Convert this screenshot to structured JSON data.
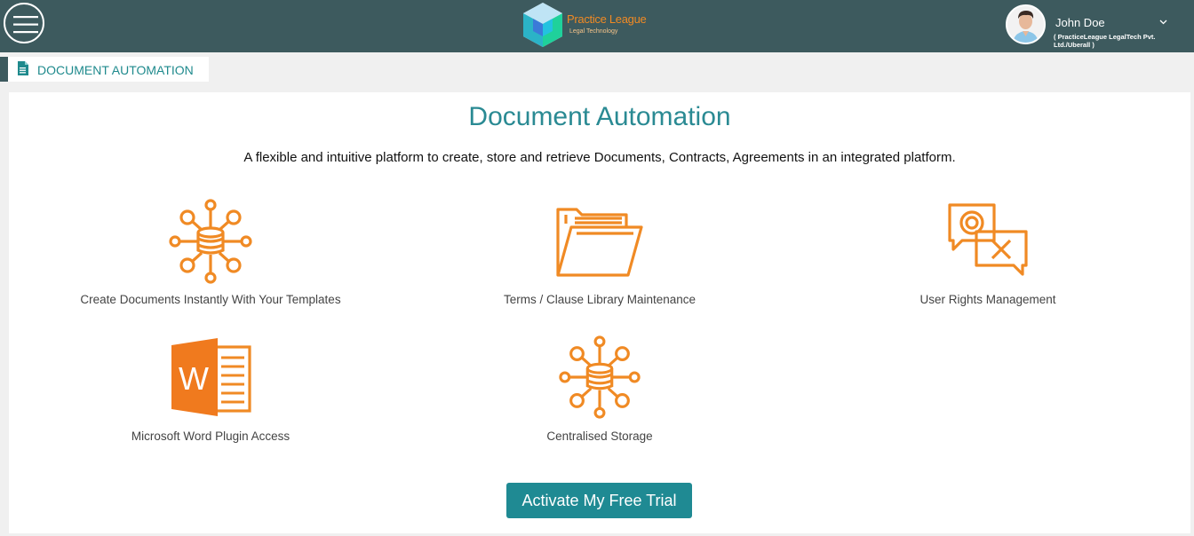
{
  "colors": {
    "topbar": "#3d5a5e",
    "accent": "#1f8a93",
    "icon": "#f08a24"
  },
  "header": {
    "menu_icon": "hamburger-icon",
    "logo": {
      "name": "Practice League",
      "tagline": "Legal Technology"
    },
    "user": {
      "name": "John Doe",
      "org": "( PracticeLeague LegalTech Pvt. Ltd./Uberall )",
      "dropdown_icon": "chevron-down-icon"
    }
  },
  "breadcrumb": {
    "icon": "document-icon",
    "label": "DOCUMENT AUTOMATION"
  },
  "main": {
    "title": "Document Automation",
    "subtitle": "A flexible and intuitive platform to create, store and retrieve Documents, Contracts, Agreements in an integrated platform.",
    "features": [
      {
        "label": "Create Documents Instantly With Your Templates",
        "icon": "database-network-icon"
      },
      {
        "label": "Terms / Clause Library Maintenance",
        "icon": "folder-icon"
      },
      {
        "label": "User Rights Management",
        "icon": "chat-rights-icon"
      },
      {
        "label": "Microsoft Word Plugin Access",
        "icon": "word-icon"
      },
      {
        "label": "Centralised Storage",
        "icon": "database-network-icon"
      }
    ],
    "cta_label": "Activate My Free Trial"
  }
}
